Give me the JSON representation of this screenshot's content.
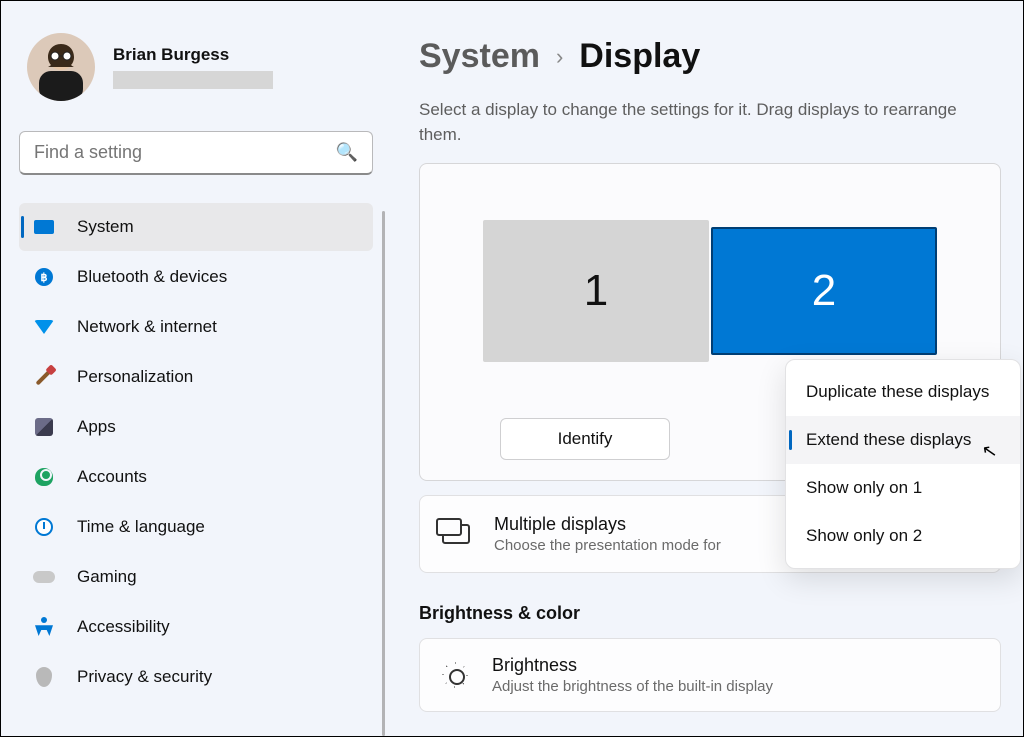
{
  "profile": {
    "name": "Brian Burgess"
  },
  "search": {
    "placeholder": "Find a setting"
  },
  "sidebar": {
    "items": [
      {
        "label": "System",
        "icon": "system-icon",
        "active": true
      },
      {
        "label": "Bluetooth & devices",
        "icon": "bluetooth-icon",
        "active": false
      },
      {
        "label": "Network & internet",
        "icon": "wifi-icon",
        "active": false
      },
      {
        "label": "Personalization",
        "icon": "personalize-icon",
        "active": false
      },
      {
        "label": "Apps",
        "icon": "apps-icon",
        "active": false
      },
      {
        "label": "Accounts",
        "icon": "accounts-icon",
        "active": false
      },
      {
        "label": "Time & language",
        "icon": "time-icon",
        "active": false
      },
      {
        "label": "Gaming",
        "icon": "gaming-icon",
        "active": false
      },
      {
        "label": "Accessibility",
        "icon": "accessibility-icon",
        "active": false
      },
      {
        "label": "Privacy & security",
        "icon": "privacy-icon",
        "active": false
      }
    ]
  },
  "breadcrumb": {
    "parent": "System",
    "current": "Display"
  },
  "description": "Select a display to change the settings for it. Drag displays to rearrange them.",
  "monitors": {
    "items": [
      {
        "id": "1",
        "selected": false
      },
      {
        "id": "2",
        "selected": true
      }
    ],
    "identify_label": "Identify"
  },
  "presentation_menu": {
    "options": [
      {
        "label": "Duplicate these displays",
        "selected": false
      },
      {
        "label": "Extend these displays",
        "selected": true
      },
      {
        "label": "Show only on 1",
        "selected": false
      },
      {
        "label": "Show only on 2",
        "selected": false
      }
    ]
  },
  "multiple_displays_card": {
    "title": "Multiple displays",
    "subtitle": "Choose the presentation mode for"
  },
  "brightness_section": {
    "heading": "Brightness & color",
    "card_title": "Brightness",
    "card_subtitle": "Adjust the brightness of the built-in display"
  },
  "colors": {
    "accent": "#0078d4"
  }
}
